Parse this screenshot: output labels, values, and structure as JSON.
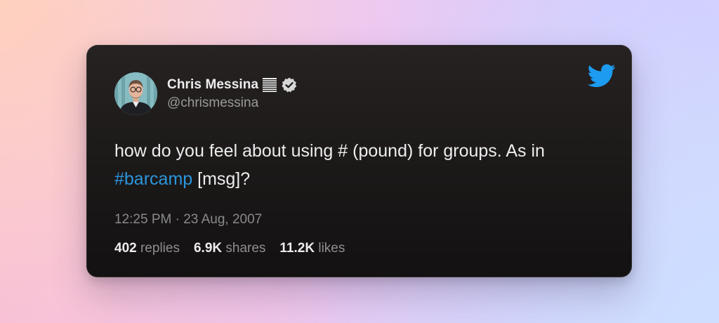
{
  "author": {
    "name": "Chris Messina",
    "handle": "@chrismessina",
    "avatar_icon": "person-avatar",
    "badge_icons": [
      "hash-flag-icon",
      "verified-badge-icon"
    ]
  },
  "tweet": {
    "text_before": "how do you feel about using # (pound) for groups. As in ",
    "hashtag": "#barcamp",
    "text_after": " [msg]?"
  },
  "meta": {
    "timestamp": "12:25 PM · 23 Aug, 2007"
  },
  "stats": {
    "replies_count": "402",
    "replies_label": "replies",
    "shares_count": "6.9K",
    "shares_label": "shares",
    "likes_count": "11.2K",
    "likes_label": "likes"
  },
  "brand": {
    "icon": "twitter-bird-icon",
    "color": "#1d9bf0",
    "hashtag_color": "#2b96dd"
  }
}
